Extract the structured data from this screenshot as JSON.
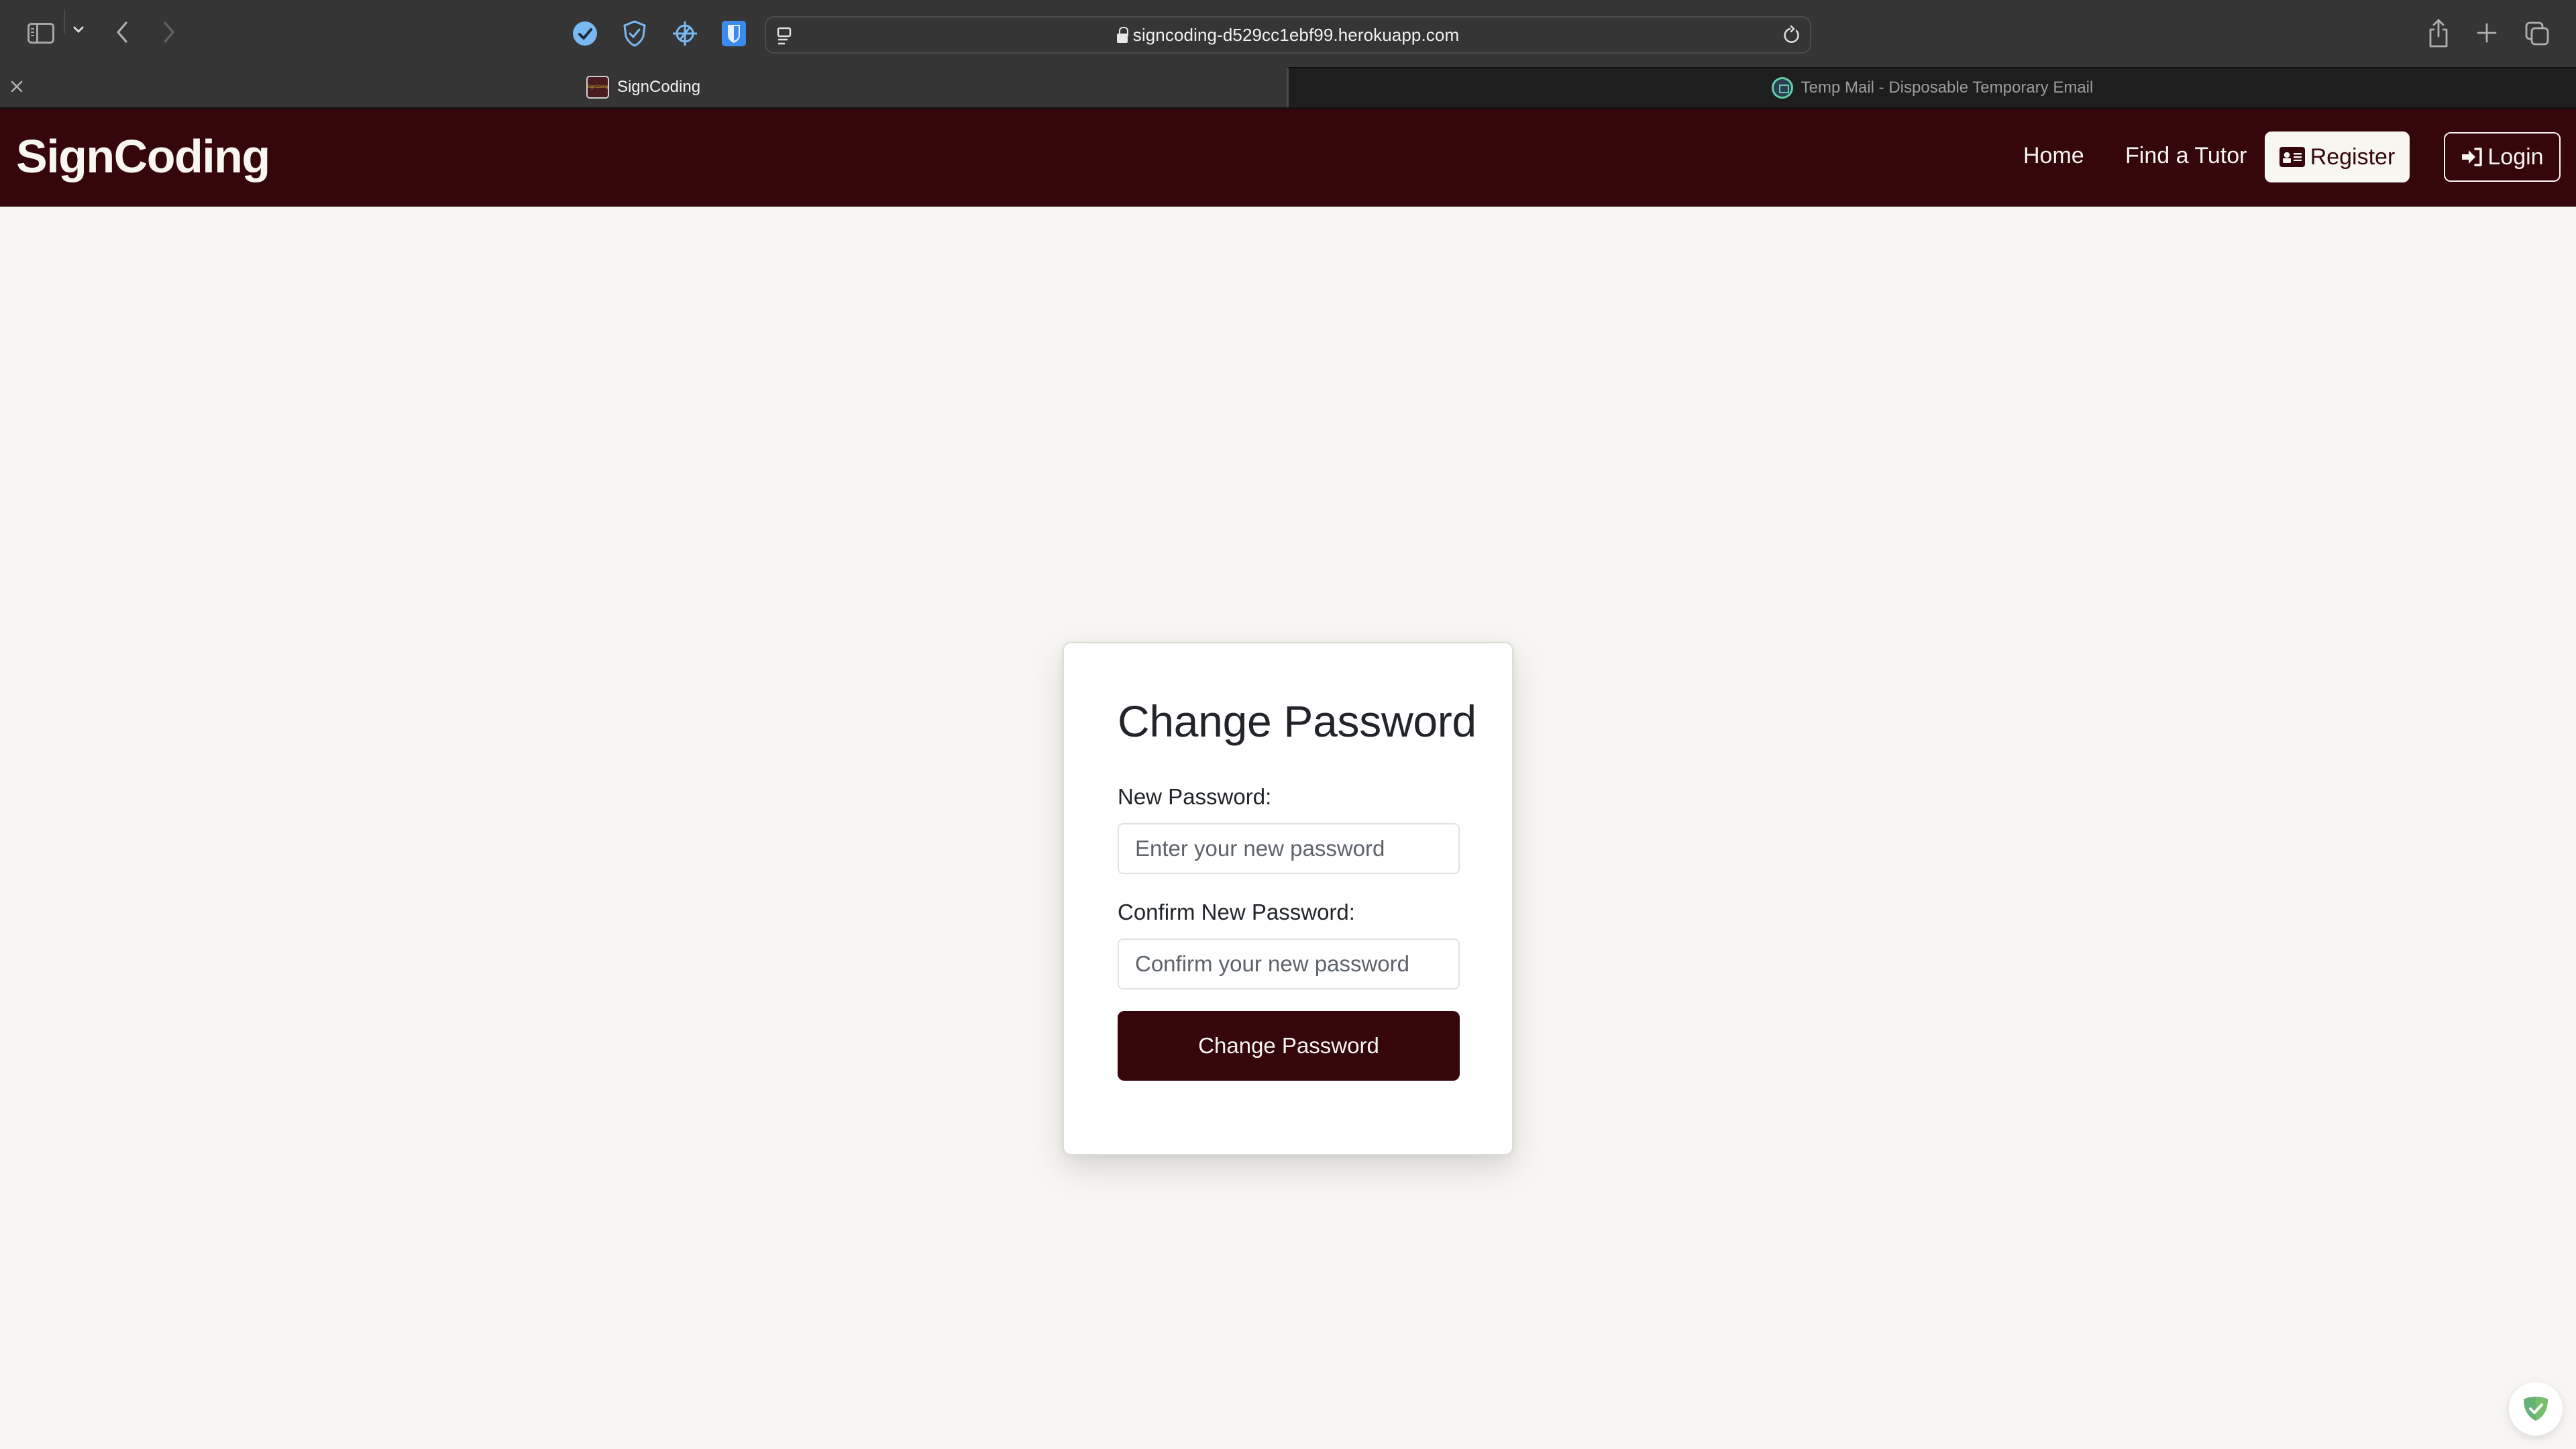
{
  "browser": {
    "url": "signcoding-d529cc1ebf99.herokuapp.com",
    "toolbar_icons": [
      "sidebar-toggle-icon",
      "chevron-down-icon",
      "back-arrow-icon",
      "forward-arrow-icon",
      "checkmark-extension-icon",
      "shield-check-extension-icon",
      "crosshair-extension-icon",
      "bitwarden-shield-icon",
      "page-menu-icon",
      "lock-icon",
      "reload-icon",
      "share-icon",
      "plus-icon",
      "tab-overview-icon"
    ],
    "tabs": [
      {
        "title": "SignCoding",
        "active": true,
        "favicon": "signcoding-favicon",
        "favicon_text": "SignCoding"
      },
      {
        "title": "Temp Mail - Disposable Temporary Email",
        "active": false,
        "favicon": "temp-mail-favicon"
      }
    ]
  },
  "site": {
    "brand": "SignCoding",
    "nav": {
      "home": "Home",
      "find_tutor": "Find a Tutor",
      "register": "Register",
      "login": "Login"
    },
    "colors": {
      "brand_primary": "#36070a",
      "brand_light": "#f8f6f0",
      "page_background": "#f8f6f2"
    }
  },
  "form": {
    "title": "Change Password",
    "new_password_label": "New Password:",
    "new_password_placeholder": "Enter your new password",
    "new_password_value": "",
    "confirm_password_label": "Confirm New Password:",
    "confirm_password_placeholder": "Confirm your new password",
    "confirm_password_value": "",
    "submit_label": "Change Password"
  },
  "overlay": {
    "extension_badge": "adguard-shield-icon",
    "badge_color": "#67b279"
  }
}
